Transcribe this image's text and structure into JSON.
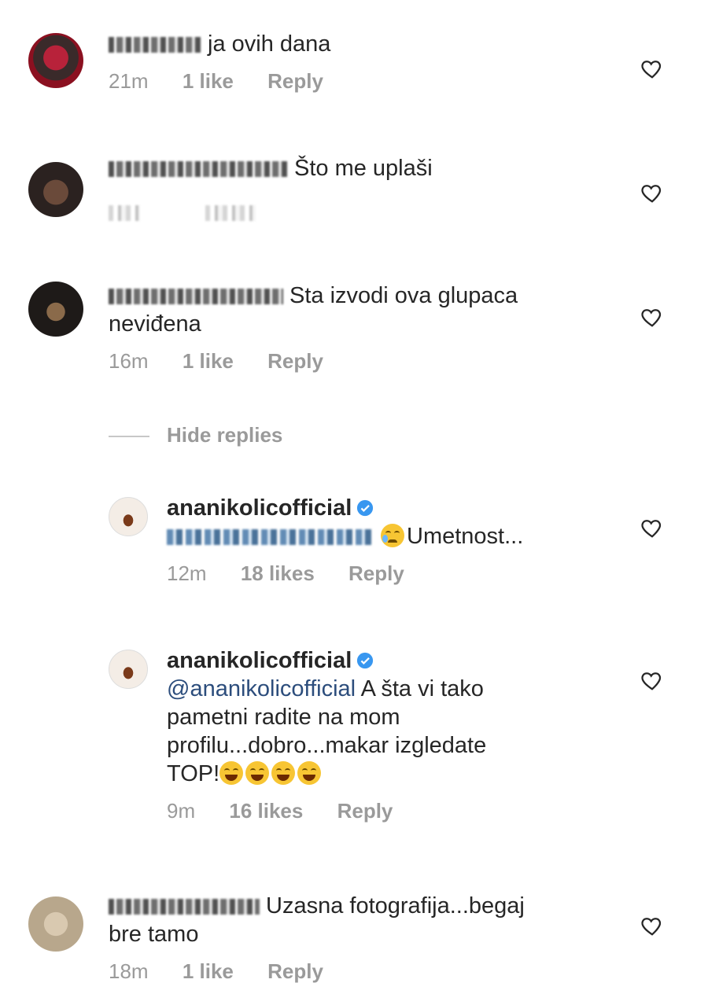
{
  "comments": [
    {
      "text": "ja ovih dana",
      "time": "21m",
      "likes": "1 like",
      "reply": "Reply"
    },
    {
      "text": "Što me uplaši"
    },
    {
      "text": "Sta izvodi ova glupaca",
      "text2": "neviđena",
      "time": "16m",
      "likes": "1 like",
      "reply": "Reply"
    }
  ],
  "hide_replies": "Hide replies",
  "replies": [
    {
      "username": "ananikolicofficial",
      "text": "Umetnost...",
      "time": "12m",
      "likes": "18 likes",
      "reply": "Reply"
    },
    {
      "username": "ananikolicofficial",
      "mention": "@ananikolicofficial",
      "text_line1": "A šta vi tako",
      "text_line2": "pametni radite na mom",
      "text_line3": "profilu...dobro...makar izgledate",
      "text_line4": "TOP!",
      "time": "9m",
      "likes": "16 likes",
      "reply": "Reply"
    }
  ],
  "last_comment": {
    "text": "Uzasna fotografija...begaj",
    "text2": "bre tamo",
    "time": "18m",
    "likes": "1 like",
    "reply": "Reply"
  },
  "icons": {
    "like": "heart-outline-icon",
    "verified": "verified-badge-icon",
    "emoji_cry": "crying-face-emoji",
    "emoji_laugh": "tears-of-joy-emoji"
  },
  "colors": {
    "text": "#262626",
    "meta": "#8e8e8e",
    "mention": "#2c4d7c",
    "verified": "#3897f0"
  }
}
